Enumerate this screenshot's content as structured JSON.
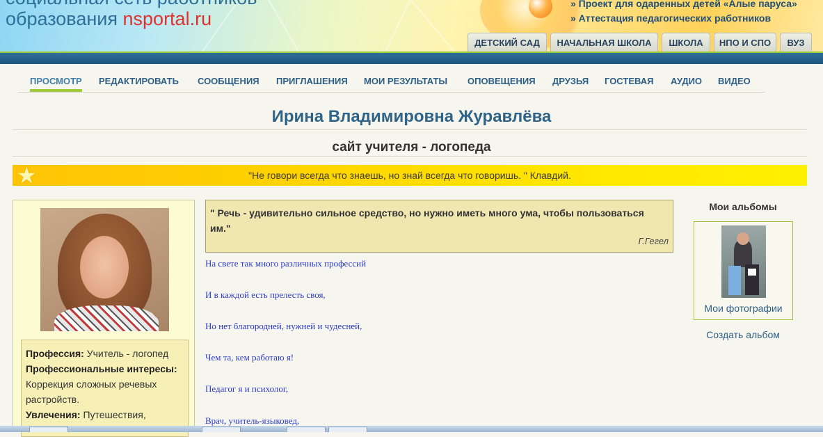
{
  "header": {
    "top_cut_text": "социальная сеть работников",
    "logo_text": "образования",
    "logo_brand_ns": "ns",
    "logo_brand_rest": "portal.ru",
    "links": [
      "» Проект для одаренных детей «Алые паруса»",
      "» Аттестация педагогических работников"
    ],
    "tabs": [
      "ДЕТСКИЙ САД",
      "НАЧАЛЬНАЯ ШКОЛА",
      "ШКОЛА",
      "НПО И СПО",
      "ВУЗ"
    ]
  },
  "menu": {
    "items": [
      "ПРОСМОТР",
      "РЕДАКТИРОВАТЬ",
      "СООБЩЕНИЯ",
      "ПРИГЛАШЕНИЯ",
      "МОИ РЕЗУЛЬТАТЫ",
      "ОПОВЕЩЕНИЯ",
      "ДРУЗЬЯ",
      "ГОСТЕВАЯ",
      "АУДИО",
      "ВИДЕО"
    ],
    "active": "ПРОСМОТР"
  },
  "page": {
    "owner_name": "Ирина Владимировна Журавлёва",
    "site_title": "сайт учителя - логопеда",
    "motto": "\"Не говори всегда что знаешь, но знай всегда что говоришь. \" Клавдий."
  },
  "profile": {
    "profession_label": "Профессия:",
    "profession_value": "Учитель - логопед",
    "interests_label": "Профессиональные интересы:",
    "interests_value": "Коррекция сложных речевых растройств.",
    "hobbies_label": "Увлечения:",
    "hobbies_value": "Путешествия,"
  },
  "quote": {
    "text": "\" Речь - удивительно сильное средство, но нужно иметь много ума, чтобы пользоваться им.\"",
    "author": "Г.Гегел"
  },
  "poem": [
    "На свете так много различных профессий",
    "И в каждой есть прелесть своя,",
    "Но нет благородней, нужней и чудесней,",
    "Чем та, кем работаю я!",
    "Педагог я и психолог,",
    "Врач, учитель-языковед,"
  ],
  "albums": {
    "heading": "Мои альбомы",
    "album_name": "Мои фотографии",
    "create_label": "Создать альбом"
  },
  "colors": {
    "accent_green": "#9fcb3b",
    "nav_blue": "#1b5580",
    "link_blue": "#2d5f86",
    "motto_yellow": "#ffd000",
    "poem_blue": "#2a3acb"
  },
  "icons": [
    "star-icon"
  ]
}
